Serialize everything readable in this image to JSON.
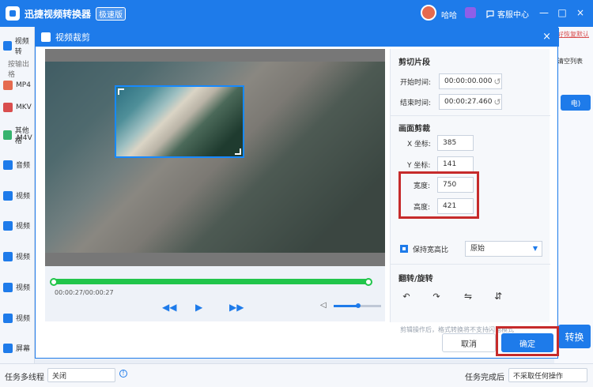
{
  "app": {
    "title": "迅捷视频转换器",
    "badge": "极速版"
  },
  "user": {
    "name": "哈哈",
    "support": "客服中心"
  },
  "left_menu": {
    "items": [
      "视频转",
      "按输出格",
      "MP4",
      "MKV",
      "其他格",
      "M4V",
      "音频",
      "视频",
      "视频",
      "视频",
      "视频",
      "视频",
      "屏幕"
    ]
  },
  "right_labels": {
    "restore": "好恢复默认",
    "clear": "清空列表",
    "convert": "转换",
    "video_btn": "电)"
  },
  "dialog": {
    "title": "视频裁剪",
    "close_label": "×",
    "section_clip": "剪切片段",
    "start_label": "开始时间:",
    "start_value": "00:00:00.000",
    "end_label": "结束时间:",
    "end_value": "00:00:27.460",
    "section_crop": "画面剪裁",
    "x_label": "X 坐标:",
    "x_value": "385",
    "y_label": "Y 坐标:",
    "y_value": "141",
    "width_label": "宽度:",
    "width_value": "750",
    "height_label": "高度:",
    "height_value": "421",
    "keep_ratio_label": "保持宽高比",
    "ratio_value": "原始",
    "section_flip": "翻转/旋转",
    "note": "剪辑操作后，格式转换将不支持闪电模式",
    "cancel": "取消",
    "confirm": "确定",
    "time_display": "00:00:27/00:00:27"
  },
  "bottom": {
    "multitask_label": "任务多线程",
    "multitask_value": "关闭",
    "after_label": "任务完成后",
    "after_value": "不采取任何操作"
  },
  "colors": {
    "primary": "#1e7bea",
    "highlight": "#c62b2b",
    "timeline": "#21c54b"
  },
  "icons": [
    "app-logo-icon",
    "vip-icon",
    "support-chat-icon",
    "minimize-icon",
    "maximize-icon",
    "close-icon",
    "rotate-left-90-icon",
    "rotate-right-90-icon",
    "flip-horizontal-icon",
    "flip-vertical-icon",
    "rewind-icon",
    "play-icon",
    "fast-forward-icon",
    "volume-icon",
    "info-icon"
  ]
}
